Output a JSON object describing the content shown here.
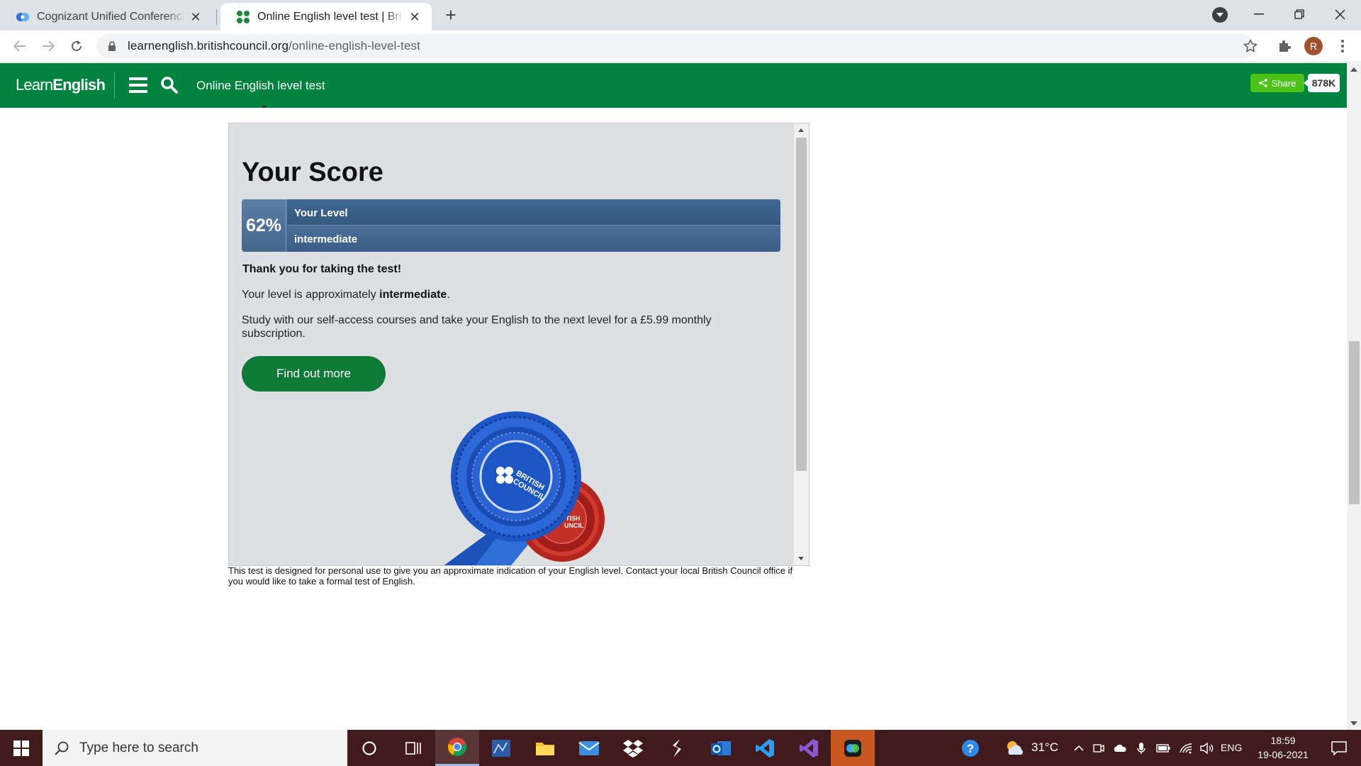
{
  "browser": {
    "tabs": [
      {
        "title": "Cognizant Unified Conferencing | ",
        "active": false,
        "favicon": "cognizant-icon"
      },
      {
        "title": "Online English level test | British Council",
        "active": true,
        "favicon": "british-council-icon"
      }
    ],
    "address": {
      "host": "learnenglish.britishcouncil.org",
      "path": "/online-english-level-test"
    },
    "profile_initial": "R"
  },
  "site_header": {
    "logo_learn": "Learn",
    "logo_english": "English",
    "title": "Online English level test",
    "share_label": "Share",
    "share_count": "878K",
    "color": "#00833e"
  },
  "result": {
    "heading": "Your Score",
    "percent": "62%",
    "level_label": "Your Level",
    "level_value": "intermediate",
    "thanks": "Thank you for taking the test!",
    "approx_prefix": "Your level is approximately ",
    "approx_level": "intermediate",
    "approx_suffix": ".",
    "study_text": "Study with our self-access courses and take your English to the next level for a £5.99 monthly subscription.",
    "button_label": "Find out more",
    "badge_text_blue": "BRITISH COUNCIL",
    "badge_text_red": "BRITISH COUNCIL"
  },
  "disclaimer": "This test is designed for personal use to give you an approximate indication of your English level. Contact your local British Council office if you would like to take a formal test of English.",
  "taskbar": {
    "search_placeholder": "Type here to search",
    "temperature": "31°C",
    "language": "ENG",
    "time": "18:59",
    "date": "19-06-2021"
  }
}
